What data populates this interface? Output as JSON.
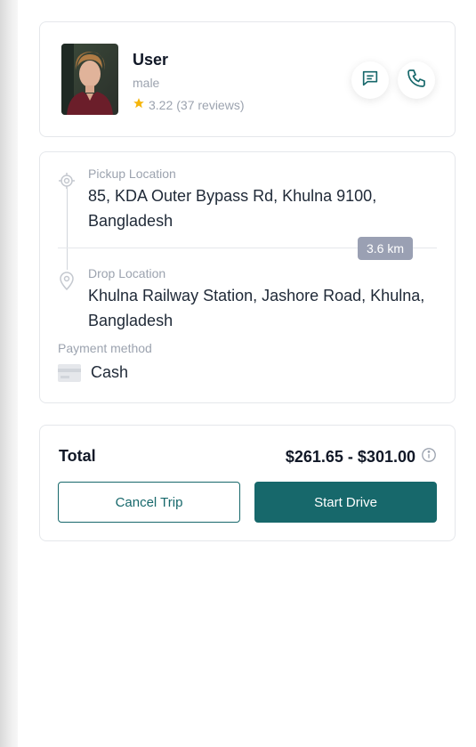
{
  "user": {
    "name": "User",
    "gender": "male",
    "rating": "3.22",
    "reviews": "(37 reviews)"
  },
  "route": {
    "pickup_label": "Pickup Location",
    "pickup_value": "85, KDA Outer Bypass Rd, Khulna 9100, Bangladesh",
    "distance": "3.6 km",
    "drop_label": "Drop Location",
    "drop_value": "Khulna Railway Station, Jashore Road, Khulna, Bangladesh",
    "payment_label": "Payment method",
    "payment_value": "Cash"
  },
  "total": {
    "label": "Total",
    "value": "$261.65 - $301.00"
  },
  "actions": {
    "cancel_label": "Cancel Trip",
    "start_label": "Start Drive"
  },
  "colors": {
    "accent": "#17686b",
    "star": "#f5b50a",
    "badge": "#9aa0b3"
  }
}
